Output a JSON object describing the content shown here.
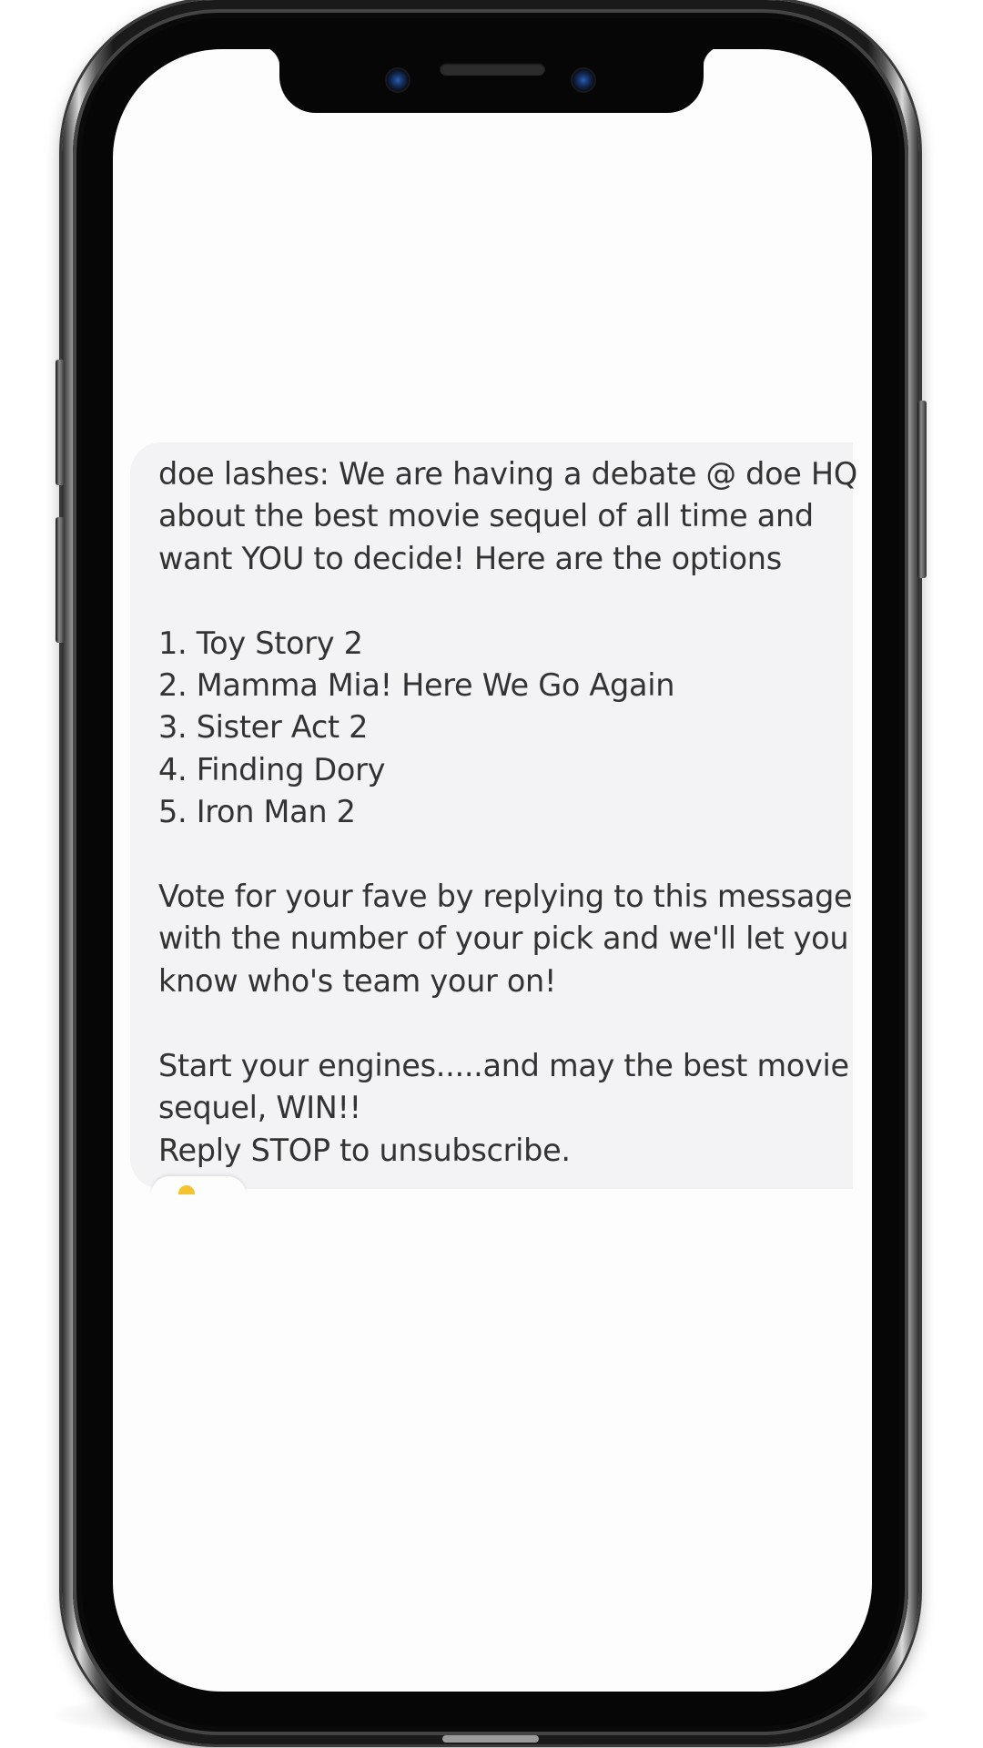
{
  "message": {
    "text": "doe lashes: We are having a debate @ doe HQ about the best movie sequel of all time and want YOU to decide! Here are the options\n\n1. Toy Story 2\n2. Mamma Mia! Here We Go Again\n3. Sister Act 2\n4. Finding Dory\n5. Iron Man 2\n\nVote for your fave by replying to this message with the number of your pick and we'll let you know who's team your on!\n\nStart your engines.....and may the best movie sequel, WIN!!\nReply STOP to unsubscribe."
  },
  "reaction": {
    "icon": "emoji-reaction-icon"
  },
  "colors": {
    "bubble": "#f3f3f6",
    "text": "#333333",
    "screen": "#fdfdfe",
    "frame": "#060606"
  }
}
